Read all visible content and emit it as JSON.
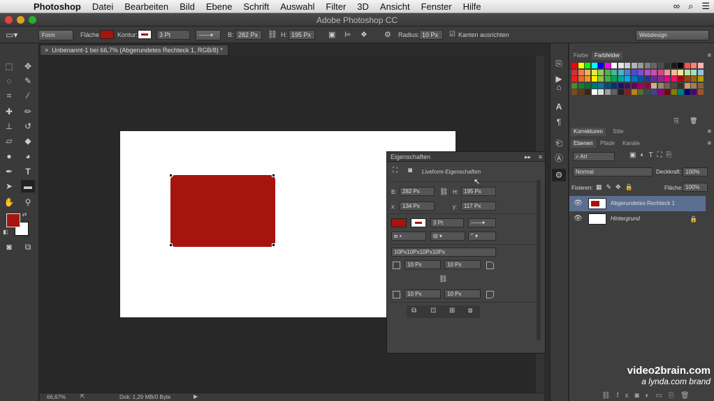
{
  "menubar": {
    "app": "Photoshop",
    "items": [
      "Datei",
      "Bearbeiten",
      "Bild",
      "Ebene",
      "Schrift",
      "Auswahl",
      "Filter",
      "3D",
      "Ansicht",
      "Fenster",
      "Hilfe"
    ]
  },
  "titlebar": {
    "title": "Adobe Photoshop CC"
  },
  "options": {
    "mode": "Form",
    "fill_label": "Fläche:",
    "fill_color": "#a5150e",
    "stroke_label": "Kontur:",
    "stroke_width": "3 Pt",
    "w_label": "B:",
    "w": "282 Px",
    "h_label": "H:",
    "h": "195 Px",
    "radius_label": "Radius:",
    "radius": "10 Px",
    "align_label": "Kanten ausrichten",
    "workspace": "Webdesign"
  },
  "doc": {
    "tab": "Unbenannt-1 bei 66,7% (Abgerundetes Rechteck 1, RGB/8) *",
    "close": "×",
    "zoom": "66,67%",
    "doc_info": "Dok: 1,29 MB/0 Byte"
  },
  "properties": {
    "title": "Eigenschaften",
    "subtitle": "Liveform-Eigenschaften",
    "b_label": "B:",
    "b": "282 Px",
    "h_label": "H:",
    "h": "195 Px",
    "x_label": "x:",
    "x": "134 Px",
    "y_label": "y:",
    "y": "117 Px",
    "stroke_width": "3 Pt",
    "radii_text": "10Px10Px10Px10Px",
    "r1": "10 Px",
    "r2": "10 Px",
    "r3": "10 Px",
    "r4": "10 Px"
  },
  "swatches_panel": {
    "tab1": "Farbe",
    "tab2": "Farbfelder"
  },
  "adjust_panel": {
    "tab1": "Korrekturen",
    "tab2": "Stile"
  },
  "layers_panel": {
    "tab1": "Ebenen",
    "tab2": "Pfade",
    "tab3": "Kanäle",
    "filter": "Art",
    "blend": "Normal",
    "opacity_label": "Deckkraft:",
    "opacity": "100%",
    "lock_label": "Fixieren:",
    "fill_label": "Fläche:",
    "fill": "100%",
    "layers": [
      {
        "name": "Abgerundetes Rechteck 1"
      },
      {
        "name": "Hintergrund"
      }
    ]
  },
  "watermark": {
    "line1": "video2brain.com",
    "line2": "a lynda.com brand"
  },
  "colors": {
    "fg": "#a5150e",
    "bg": "#ffffff",
    "shape": "#a5150e"
  }
}
